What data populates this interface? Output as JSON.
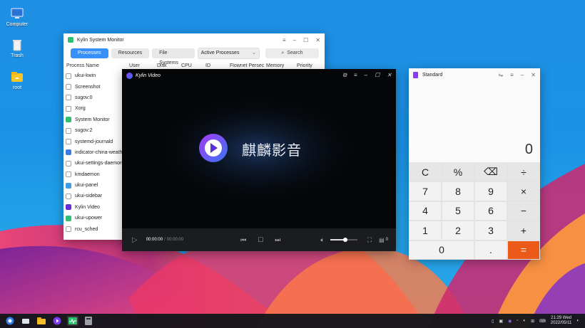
{
  "desktop": {
    "icons": [
      {
        "label": "Computer"
      },
      {
        "label": "Trash"
      },
      {
        "label": "root"
      }
    ]
  },
  "sysmon": {
    "title": "Kylin System Monitor",
    "tabs": [
      "Processes",
      "Resources",
      "File Systems"
    ],
    "filter": "Active Processes",
    "search": "Search",
    "columns": [
      "Process Name",
      "User",
      "Disk",
      "CPU",
      "ID",
      "Flownet Persec",
      "Memory",
      "Priority"
    ],
    "processes": [
      {
        "name": "ukui-kwin",
        "color": "#9aa0a6"
      },
      {
        "name": "Screenshot",
        "color": "#9aa0a6"
      },
      {
        "name": "sugov:0",
        "color": "#9aa0a6"
      },
      {
        "name": "Xorg",
        "color": "#9aa0a6"
      },
      {
        "name": "System Monitor",
        "color": "#2fbf71"
      },
      {
        "name": "sugov:2",
        "color": "#9aa0a6"
      },
      {
        "name": "systemd-journald",
        "color": "#9aa0a6"
      },
      {
        "name": "indicator-china-weathe",
        "color": "#3d7be0"
      },
      {
        "name": "ukui-settings-daemon",
        "color": "#9aa0a6"
      },
      {
        "name": "kmdaemon",
        "color": "#9aa0a6"
      },
      {
        "name": "ukui-panel",
        "color": "#3d9be9"
      },
      {
        "name": "ukui-sidebar",
        "color": "#9aa0a6"
      },
      {
        "name": "Kylin Video",
        "color": "#6b2bd9"
      },
      {
        "name": "ukui-upower",
        "color": "#2fbf71"
      },
      {
        "name": "rcu_sched",
        "color": "#9aa0a6"
      }
    ]
  },
  "video": {
    "title": "Kylin Video",
    "logo_text": "麒麟影音",
    "time_current": "00:00:00",
    "time_separator": "/",
    "time_total": "00:00:00",
    "volume_level": 0.55,
    "playlist_count": "0"
  },
  "calc": {
    "mode": "Standard",
    "display": "0",
    "keys": [
      "C",
      "%",
      "⌫",
      "÷",
      "7",
      "8",
      "9",
      "×",
      "4",
      "5",
      "6",
      "−",
      "1",
      "2",
      "3",
      "+",
      "0",
      ".",
      "="
    ]
  },
  "taskbar": {
    "time": "21:29 Wed",
    "date": "2022/05/11"
  }
}
